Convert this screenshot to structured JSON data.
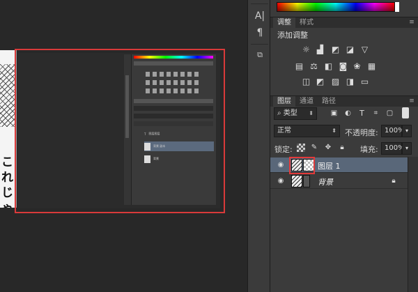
{
  "canvas": {
    "manga_text": "これじゃ"
  },
  "thumbnail": {
    "layers": [
      {
        "name": "图层图层"
      },
      {
        "name": "背景 副本"
      },
      {
        "name": "背景"
      }
    ]
  },
  "midbar": {
    "icons": [
      "character-icon",
      "paragraph-icon",
      "3d-material-icon"
    ]
  },
  "adjustments": {
    "tabs": [
      {
        "label": "调整"
      },
      {
        "label": "样式"
      }
    ],
    "title": "添加调整"
  },
  "layers_panel": {
    "tabs": [
      {
        "label": "图层"
      },
      {
        "label": "通道"
      },
      {
        "label": "路径"
      }
    ],
    "filter_kind": "类型",
    "blend_mode": "正常",
    "opacity_label": "不透明度:",
    "opacity_value": "100%",
    "lock_label": "锁定:",
    "fill_label": "填充:",
    "fill_value": "100%",
    "layers": [
      {
        "name": "图层 1",
        "selected": true
      },
      {
        "name": "背景",
        "selected": false,
        "locked": true
      }
    ]
  },
  "colors": {
    "panel_bg": "#3b3b3b",
    "canvas_bg": "#282828",
    "selection": "#596779",
    "highlight_red": "#d93a3a"
  }
}
